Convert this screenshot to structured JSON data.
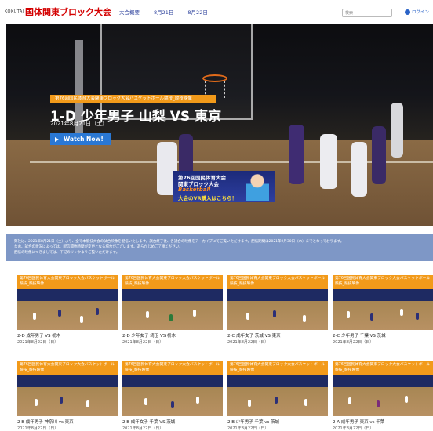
{
  "nav": {
    "brand_small": "KOKUTAI",
    "site_title": "国体関東ブロック大会",
    "links": [
      "大会概要",
      "8月21日",
      "8月22日"
    ],
    "search_placeholder": "検索",
    "login_label": "ログイン"
  },
  "hero": {
    "tag": "第76回国民体育大会関東ブロック大会バスケットボール競技_競技映像",
    "title": "1-D 少年男子 山梨 VS 東京",
    "date": "2021年8月21日（土）",
    "watch_label": "Watch Now!",
    "promo": {
      "line1": "第76回国民体育大会",
      "line2": "関東ブロック大会",
      "line3": "Basketball",
      "line4": "大会のVR購入はこちら！"
    }
  },
  "notice": {
    "line1": "弊社は、2021年8月21日（土）より、全で本競技大会の試合映像を配信いたします。試合終了後、各試合の映像をアーカイブにてご覧いただけます。配信期間は2021年9月30日（木）までとなっております。",
    "line2": "なお、試合の状況によっては、配信開始時間が変更となる場合がございます。あらかじめご了承ください。",
    "line3": "配信の映像につきましては、下記のリンクよりご覧いただけます。"
  },
  "videos": [
    {
      "banner": "第76回国民体育大会関東ブロック大会バスケットボール競技_競技映像",
      "title": "2-D 成年男子 VS 栃木",
      "date": "2021年8月22日（日）"
    },
    {
      "banner": "第76回国民体育大会関東ブロック大会バスケットボール競技_競技映像",
      "title": "2-D 少年女子 埼玉 VS 栃木",
      "date": "2021年8月22日（日）"
    },
    {
      "banner": "第76回国民体育大会関東ブロック大会バスケットボール競技_競技映像",
      "title": "2-C 成年女子 茨城 VS 東京",
      "date": "2021年8月22日（日）"
    },
    {
      "banner": "第76回国民体育大会関東ブロック大会バスケットボール競技_競技映像",
      "title": "2-C 少年男子 千葉 VS 茨城",
      "date": "2021年8月22日（日）"
    },
    {
      "banner": "第76回国民体育大会関東ブロック大会バスケットボール競技_競技映像",
      "title": "2-B 成年男子 神奈川 vs 東京",
      "date": "2021年8月22日（日）"
    },
    {
      "banner": "第76回国民体育大会関東ブロック大会バスケットボール競技_競技映像",
      "title": "2-B 成年女子 千葉 VS 茨城",
      "date": "2021年8月22日（日）"
    },
    {
      "banner": "第76回国民体育大会関東ブロック大会バスケットボール競技_競技映像",
      "title": "2-B 少年男子 千葉 vs 茨城",
      "date": "2021年8月22日（日）"
    },
    {
      "banner": "第76回国民体育大会関東ブロック大会バスケットボール競技_競技映像",
      "title": "2-A 成年男子 東京 vs 千葉",
      "date": "2021年8月22日（日）"
    }
  ],
  "colors": {
    "title_red": "#d40000",
    "nav_blue": "#2a3f9b",
    "accent_orange": "#f29a1a",
    "button_blue": "#2a78d4",
    "notice_bg": "#7e97c6"
  }
}
